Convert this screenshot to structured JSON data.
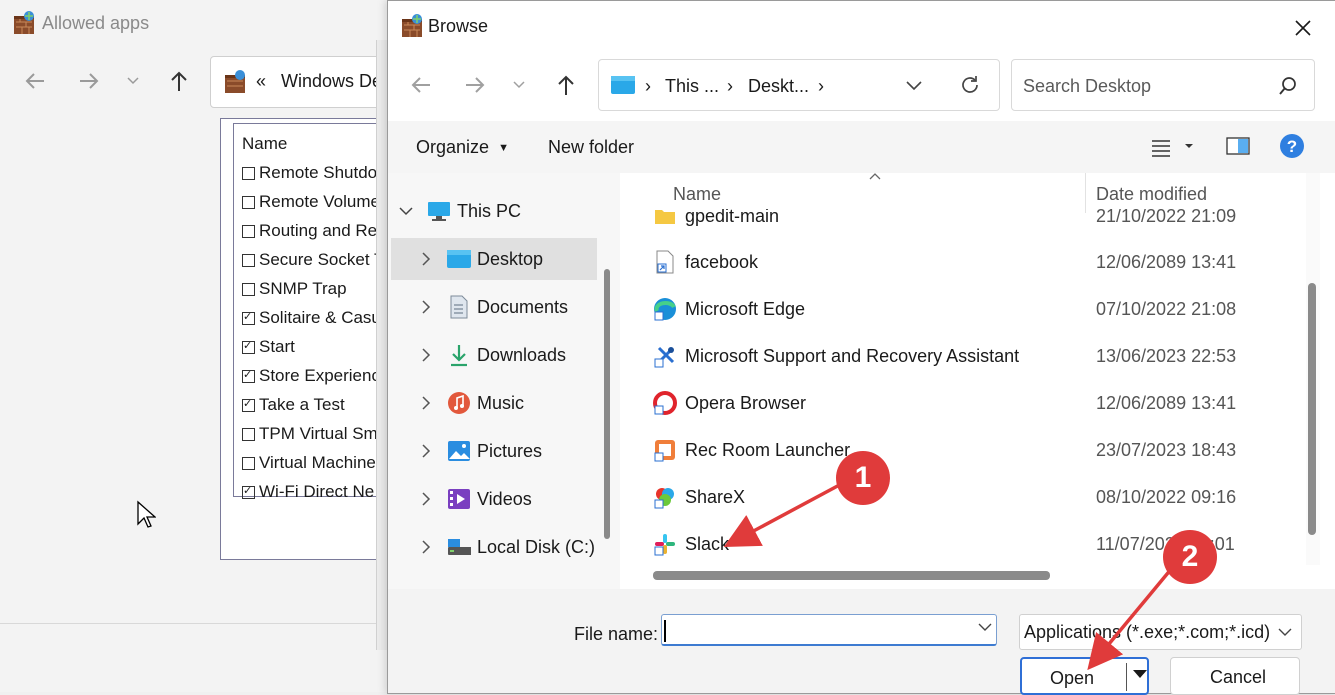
{
  "background_window": {
    "title": "Allowed apps",
    "address_prefix": "«",
    "address_text": "Windows De",
    "list_header": "Name",
    "items": [
      {
        "label": "Remote Shutdo",
        "checked": false
      },
      {
        "label": "Remote Volume",
        "checked": false
      },
      {
        "label": "Routing and Re",
        "checked": false
      },
      {
        "label": "Secure Socket T",
        "checked": false
      },
      {
        "label": "SNMP Trap",
        "checked": false
      },
      {
        "label": "Solitaire & Casu",
        "checked": true
      },
      {
        "label": "Start",
        "checked": true
      },
      {
        "label": "Store Experienc",
        "checked": true
      },
      {
        "label": "Take a Test",
        "checked": true
      },
      {
        "label": "TPM Virtual Sm",
        "checked": false
      },
      {
        "label": "Virtual Machine",
        "checked": false
      },
      {
        "label": "Wi-Fi Direct Ne",
        "checked": true
      }
    ]
  },
  "dialog": {
    "title": "Browse",
    "breadcrumb": [
      "This ...",
      "Deskt..."
    ],
    "search_placeholder": "Search Desktop",
    "organize_label": "Organize",
    "new_folder_label": "New folder",
    "help_glyph": "?",
    "nav_items": [
      {
        "label": "This PC",
        "icon": "pc-icon",
        "selected": false
      },
      {
        "label": "Desktop",
        "icon": "desktop-icon",
        "selected": true
      },
      {
        "label": "Documents",
        "icon": "documents-icon",
        "selected": false
      },
      {
        "label": "Downloads",
        "icon": "downloads-icon",
        "selected": false
      },
      {
        "label": "Music",
        "icon": "music-icon",
        "selected": false
      },
      {
        "label": "Pictures",
        "icon": "pictures-icon",
        "selected": false
      },
      {
        "label": "Videos",
        "icon": "videos-icon",
        "selected": false
      },
      {
        "label": "Local Disk (C:)",
        "icon": "disk-icon",
        "selected": false
      }
    ],
    "columns": {
      "name": "Name",
      "date": "Date modified"
    },
    "files": [
      {
        "name": "gpedit-main",
        "date": "21/10/2022 21:09",
        "icon": "folder-icon"
      },
      {
        "name": "facebook",
        "date": "12/06/2089 13:41",
        "icon": "shortcut-icon"
      },
      {
        "name": "Microsoft Edge",
        "date": "07/10/2022 21:08",
        "icon": "edge-icon"
      },
      {
        "name": "Microsoft Support and Recovery Assistant",
        "date": "13/06/2023 22:53",
        "icon": "tools-icon"
      },
      {
        "name": "Opera Browser",
        "date": "12/06/2089 13:41",
        "icon": "opera-icon"
      },
      {
        "name": "Rec Room Launcher",
        "date": "23/07/2023 18:43",
        "icon": "recroom-icon"
      },
      {
        "name": "ShareX",
        "date": "08/10/2022 09:16",
        "icon": "sharex-icon"
      },
      {
        "name": "Slack",
        "date": "11/07/2023 13:01",
        "icon": "slack-icon"
      }
    ],
    "file_name_label": "File name:",
    "file_name_value": "",
    "file_type": "Applications (*.exe;*.com;*.icd)",
    "open_label": "Open",
    "cancel_label": "Cancel"
  },
  "annotations": [
    "1",
    "2"
  ],
  "colors": {
    "accent": "#2f6fd6",
    "annotation": "#e03b3b"
  }
}
